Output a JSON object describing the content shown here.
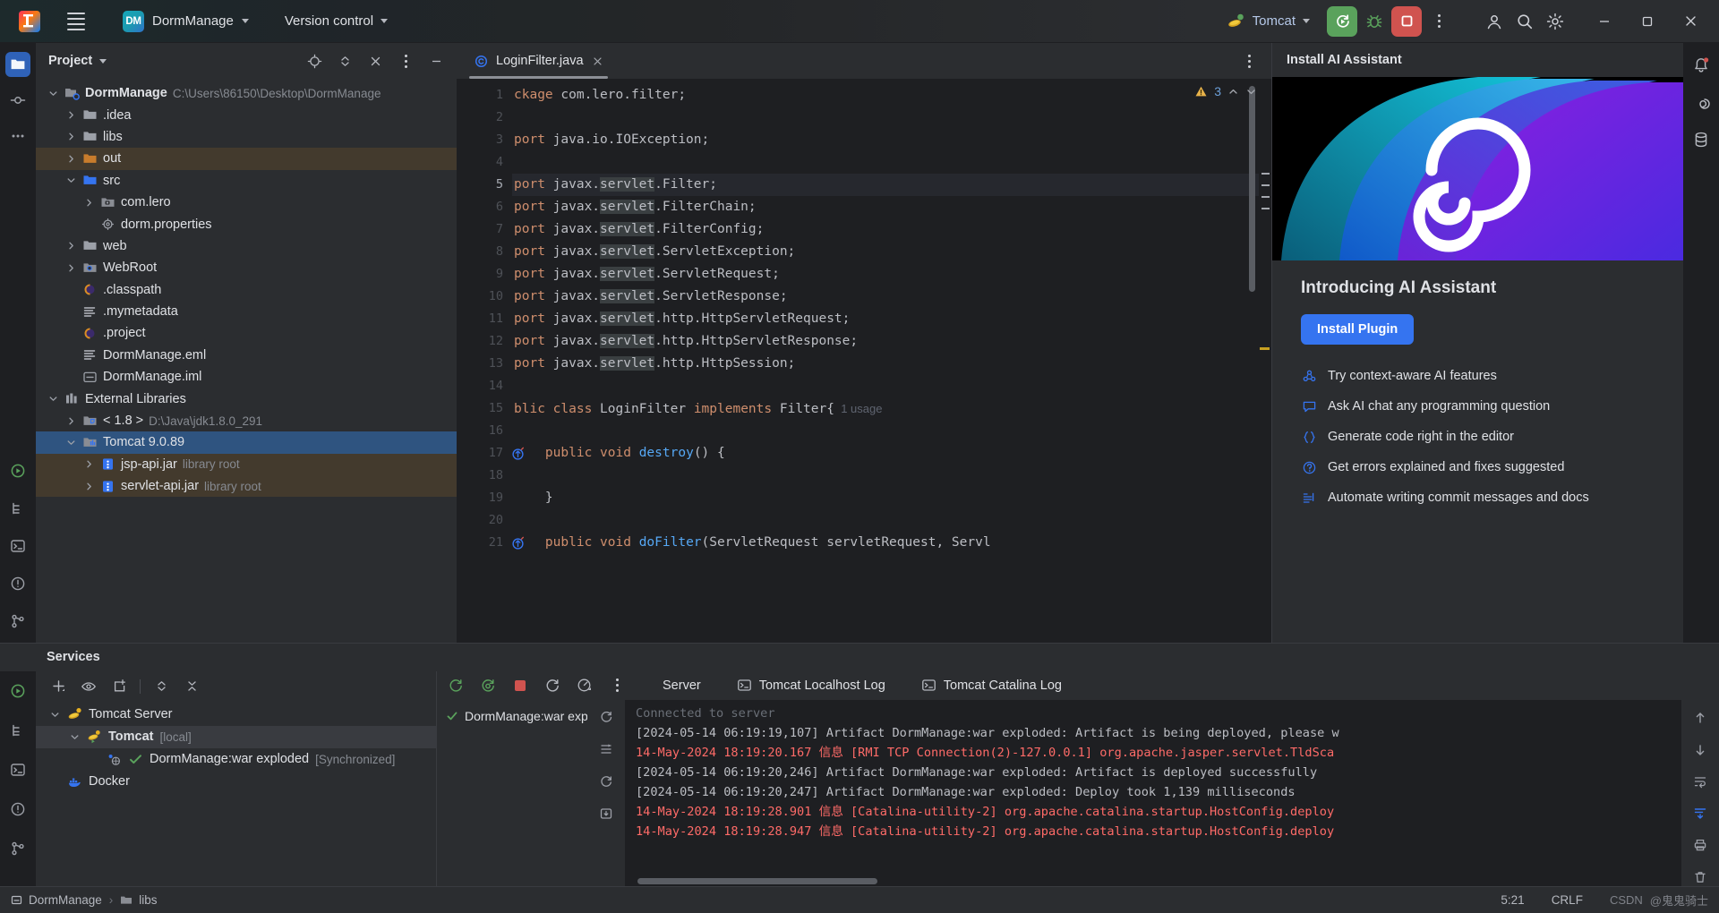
{
  "titlebar": {
    "menu_icon": "hamburger-icon",
    "project_badge": "DM",
    "project_name": "DormManage",
    "version_control": "Version control",
    "run_config": "Tomcat",
    "run_icon": "run-with-reload-icon",
    "debug_icon": "debug-icon",
    "stop_icon": "stop-icon",
    "more_icon": "kebab-icon",
    "account_icon": "account-icon",
    "search_icon": "search-icon",
    "settings_icon": "gear-icon",
    "minimize": "minimize-icon",
    "maximize": "maximize-icon",
    "close": "close-icon"
  },
  "left_rail": {
    "items": [
      {
        "name": "project-tool-window",
        "icon": "folder-icon",
        "active": true
      },
      {
        "name": "commit-tool-window",
        "icon": "commit-icon",
        "active": false
      },
      {
        "name": "more-tool-windows",
        "icon": "ellipsis-icon",
        "active": false
      }
    ],
    "bottom": [
      {
        "name": "run-tool-window",
        "icon": "run-icon"
      },
      {
        "name": "structure-tool-window",
        "icon": "structure-icon"
      },
      {
        "name": "terminal-tool-window",
        "icon": "terminal-icon"
      },
      {
        "name": "problems-tool-window",
        "icon": "problems-icon"
      },
      {
        "name": "version-control-tool-window",
        "icon": "branch-icon"
      }
    ]
  },
  "project_panel": {
    "title": "Project",
    "header_icons": [
      "locate-icon",
      "expand-collapse-icon",
      "close-icon",
      "kebab-icon",
      "minimize-icon"
    ],
    "tree": [
      {
        "depth": 0,
        "arrow": "down",
        "icon": "project-root-icon",
        "label": "DormManage",
        "bold": true,
        "sub": "C:\\Users\\86150\\Desktop\\DormManage",
        "state": "none"
      },
      {
        "depth": 1,
        "arrow": "right",
        "icon": "folder-icon",
        "label": ".idea",
        "bold": false,
        "sub": "",
        "state": "none"
      },
      {
        "depth": 1,
        "arrow": "right",
        "icon": "folder-icon",
        "label": "libs",
        "bold": false,
        "sub": "",
        "state": "none"
      },
      {
        "depth": 1,
        "arrow": "right",
        "icon": "folder-orange-icon",
        "label": "out",
        "bold": false,
        "sub": "",
        "state": "brown"
      },
      {
        "depth": 1,
        "arrow": "down",
        "icon": "folder-blue-icon",
        "label": "src",
        "bold": false,
        "sub": "",
        "state": "none"
      },
      {
        "depth": 2,
        "arrow": "right",
        "icon": "package-icon",
        "label": "com.lero",
        "bold": false,
        "sub": "",
        "state": "none"
      },
      {
        "depth": 2,
        "arrow": "none",
        "icon": "properties-icon",
        "label": "dorm.properties",
        "bold": false,
        "sub": "",
        "state": "none"
      },
      {
        "depth": 1,
        "arrow": "right",
        "icon": "folder-icon",
        "label": "web",
        "bold": false,
        "sub": "",
        "state": "none"
      },
      {
        "depth": 1,
        "arrow": "right",
        "icon": "webroot-icon",
        "label": "WebRoot",
        "bold": false,
        "sub": "",
        "state": "none"
      },
      {
        "depth": 1,
        "arrow": "none",
        "icon": "eclipse-file-icon",
        "label": ".classpath",
        "bold": false,
        "sub": "",
        "state": "none"
      },
      {
        "depth": 1,
        "arrow": "none",
        "icon": "text-file-icon",
        "label": ".mymetadata",
        "bold": false,
        "sub": "",
        "state": "none"
      },
      {
        "depth": 1,
        "arrow": "none",
        "icon": "eclipse-file-icon",
        "label": ".project",
        "bold": false,
        "sub": "",
        "state": "none"
      },
      {
        "depth": 1,
        "arrow": "none",
        "icon": "text-file-icon",
        "label": "DormManage.eml",
        "bold": false,
        "sub": "",
        "state": "none"
      },
      {
        "depth": 1,
        "arrow": "none",
        "icon": "module-icon",
        "label": "DormManage.iml",
        "bold": false,
        "sub": "",
        "state": "none"
      },
      {
        "depth": 0,
        "arrow": "down",
        "icon": "libraries-icon",
        "label": "External Libraries",
        "bold": false,
        "sub": "",
        "state": "none"
      },
      {
        "depth": 1,
        "arrow": "right",
        "icon": "jdk-icon",
        "label": "< 1.8 >",
        "bold": false,
        "sub": "D:\\Java\\jdk1.8.0_291",
        "state": "none"
      },
      {
        "depth": 1,
        "arrow": "down",
        "icon": "library-icon",
        "label": "Tomcat 9.0.89",
        "bold": false,
        "sub": "",
        "state": "blue"
      },
      {
        "depth": 2,
        "arrow": "right",
        "icon": "jar-icon",
        "label": "jsp-api.jar",
        "bold": false,
        "sub": "library root",
        "state": "brown"
      },
      {
        "depth": 2,
        "arrow": "right",
        "icon": "jar-icon",
        "label": "servlet-api.jar",
        "bold": false,
        "sub": "library root",
        "state": "brown"
      }
    ]
  },
  "editor": {
    "tab": {
      "label": "LoginFilter.java",
      "icon": "java-class-icon",
      "close": "close-icon"
    },
    "tab_more_icon": "kebab-icon",
    "warning_count": "3",
    "warning_icon": "warning-triangle-icon",
    "prev_icon": "chevron-up-icon",
    "next_icon": "chevron-down-icon",
    "lines": [
      {
        "no": "1",
        "current": false,
        "gutter_icon": "",
        "segments": [
          {
            "t": "ckage",
            "c": "kw"
          },
          {
            "t": " com.lero.filter;",
            "c": "pl"
          }
        ]
      },
      {
        "no": "2",
        "current": false,
        "gutter_icon": "",
        "segments": []
      },
      {
        "no": "3",
        "current": false,
        "gutter_icon": "",
        "segments": [
          {
            "t": "port",
            "c": "kw"
          },
          {
            "t": " java.io.IOException;",
            "c": "pl"
          }
        ]
      },
      {
        "no": "4",
        "current": false,
        "gutter_icon": "",
        "segments": []
      },
      {
        "no": "5",
        "current": true,
        "gutter_icon": "",
        "segments": [
          {
            "t": "port",
            "c": "kw"
          },
          {
            "t": " javax.",
            "c": "pl"
          },
          {
            "t": "servlet",
            "c": "hl"
          },
          {
            "t": ".Filter;",
            "c": "pl"
          }
        ]
      },
      {
        "no": "6",
        "current": false,
        "gutter_icon": "",
        "segments": [
          {
            "t": "port",
            "c": "kw"
          },
          {
            "t": " javax.",
            "c": "pl"
          },
          {
            "t": "servlet",
            "c": "hl"
          },
          {
            "t": ".FilterChain;",
            "c": "pl"
          }
        ]
      },
      {
        "no": "7",
        "current": false,
        "gutter_icon": "",
        "segments": [
          {
            "t": "port",
            "c": "kw"
          },
          {
            "t": " javax.",
            "c": "pl"
          },
          {
            "t": "servlet",
            "c": "hl"
          },
          {
            "t": ".FilterConfig;",
            "c": "pl"
          }
        ]
      },
      {
        "no": "8",
        "current": false,
        "gutter_icon": "",
        "segments": [
          {
            "t": "port",
            "c": "kw"
          },
          {
            "t": " javax.",
            "c": "pl"
          },
          {
            "t": "servlet",
            "c": "hl"
          },
          {
            "t": ".ServletException;",
            "c": "pl"
          }
        ]
      },
      {
        "no": "9",
        "current": false,
        "gutter_icon": "",
        "segments": [
          {
            "t": "port",
            "c": "kw"
          },
          {
            "t": " javax.",
            "c": "pl"
          },
          {
            "t": "servlet",
            "c": "hl"
          },
          {
            "t": ".ServletRequest;",
            "c": "pl"
          }
        ]
      },
      {
        "no": "10",
        "current": false,
        "gutter_icon": "",
        "segments": [
          {
            "t": "port",
            "c": "kw"
          },
          {
            "t": " javax.",
            "c": "pl"
          },
          {
            "t": "servlet",
            "c": "hl"
          },
          {
            "t": ".ServletResponse;",
            "c": "pl"
          }
        ]
      },
      {
        "no": "11",
        "current": false,
        "gutter_icon": "",
        "segments": [
          {
            "t": "port",
            "c": "kw"
          },
          {
            "t": " javax.",
            "c": "pl"
          },
          {
            "t": "servlet",
            "c": "hl"
          },
          {
            "t": ".http.HttpServletRequest;",
            "c": "pl"
          }
        ]
      },
      {
        "no": "12",
        "current": false,
        "gutter_icon": "",
        "segments": [
          {
            "t": "port",
            "c": "kw"
          },
          {
            "t": " javax.",
            "c": "pl"
          },
          {
            "t": "servlet",
            "c": "hl"
          },
          {
            "t": ".http.HttpServletResponse;",
            "c": "pl"
          }
        ]
      },
      {
        "no": "13",
        "current": false,
        "gutter_icon": "",
        "segments": [
          {
            "t": "port",
            "c": "kw"
          },
          {
            "t": " javax.",
            "c": "pl"
          },
          {
            "t": "servlet",
            "c": "hl"
          },
          {
            "t": ".http.HttpSession;",
            "c": "pl"
          }
        ]
      },
      {
        "no": "14",
        "current": false,
        "gutter_icon": "",
        "segments": []
      },
      {
        "no": "15",
        "current": false,
        "gutter_icon": "",
        "segments": [
          {
            "t": "blic",
            "c": "kw"
          },
          {
            "t": " ",
            "c": "pl"
          },
          {
            "t": "class",
            "c": "kw"
          },
          {
            "t": " LoginFilter ",
            "c": "pl"
          },
          {
            "t": "implements",
            "c": "kw"
          },
          {
            "t": " Filter{",
            "c": "pl"
          },
          {
            "t": "  1 usage",
            "c": "usage"
          }
        ]
      },
      {
        "no": "16",
        "current": false,
        "gutter_icon": "",
        "segments": []
      },
      {
        "no": "17",
        "current": false,
        "gutter_icon": "override-icon",
        "segments": [
          {
            "t": "    ",
            "c": "pl"
          },
          {
            "t": "public",
            "c": "kw"
          },
          {
            "t": " ",
            "c": "pl"
          },
          {
            "t": "void",
            "c": "kw"
          },
          {
            "t": " ",
            "c": "pl"
          },
          {
            "t": "destroy",
            "c": "fn"
          },
          {
            "t": "() {",
            "c": "pl"
          }
        ]
      },
      {
        "no": "18",
        "current": false,
        "gutter_icon": "",
        "segments": []
      },
      {
        "no": "19",
        "current": false,
        "gutter_icon": "",
        "segments": [
          {
            "t": "    }",
            "c": "pl"
          }
        ]
      },
      {
        "no": "20",
        "current": false,
        "gutter_icon": "",
        "segments": []
      },
      {
        "no": "21",
        "current": false,
        "gutter_icon": "override-icon",
        "segments": [
          {
            "t": "    ",
            "c": "pl"
          },
          {
            "t": "public",
            "c": "kw"
          },
          {
            "t": " ",
            "c": "pl"
          },
          {
            "t": "void",
            "c": "kw"
          },
          {
            "t": " ",
            "c": "pl"
          },
          {
            "t": "doFilter",
            "c": "fn"
          },
          {
            "t": "(ServletRequest servletRequest, Servl",
            "c": "pl"
          }
        ]
      }
    ]
  },
  "ai_panel": {
    "header": "Install AI Assistant",
    "title": "Introducing AI Assistant",
    "install_button": "Install Plugin",
    "features": [
      {
        "icon": "context-aware-icon",
        "label": "Try context-aware AI features"
      },
      {
        "icon": "chat-icon",
        "label": "Ask AI chat any programming question"
      },
      {
        "icon": "braces-icon",
        "label": "Generate code right in the editor"
      },
      {
        "icon": "question-icon",
        "label": "Get errors explained and fixes suggested"
      },
      {
        "icon": "commit-doc-icon",
        "label": "Automate writing commit messages and docs"
      }
    ]
  },
  "right_rail": {
    "items": [
      {
        "name": "notifications",
        "icon": "bell-icon"
      },
      {
        "name": "ai-assistant",
        "icon": "ai-icon"
      },
      {
        "name": "database",
        "icon": "database-icon"
      }
    ]
  },
  "services": {
    "title": "Services",
    "toolbar": [
      {
        "name": "add",
        "icon": "plus-icon"
      },
      {
        "name": "show",
        "icon": "eye-icon"
      },
      {
        "name": "new-tab",
        "icon": "new-tab-icon"
      },
      {
        "name": "expand-collapse",
        "icon": "expand-collapse-icon"
      },
      {
        "name": "collapse-all",
        "icon": "collapse-all-icon"
      }
    ],
    "tree": [
      {
        "depth": 0,
        "arrow": "down",
        "icon": "tomcat-icon",
        "label": "Tomcat Server",
        "bold": false,
        "sub": "",
        "sel": false,
        "check": false
      },
      {
        "depth": 1,
        "arrow": "down",
        "icon": "tomcat-run-icon",
        "label": "Tomcat",
        "bold": true,
        "sub": "[local]",
        "sel": true,
        "check": false
      },
      {
        "depth": 2,
        "arrow": "none",
        "icon": "artifact-icon",
        "label": "DormManage:war exploded",
        "bold": false,
        "sub": "[Synchronized]",
        "sel": false,
        "check": true
      },
      {
        "depth": 0,
        "arrow": "none",
        "icon": "docker-icon",
        "label": "Docker",
        "bold": false,
        "sub": "",
        "sel": false,
        "check": false
      }
    ],
    "right_toolbar": [
      {
        "name": "rerun",
        "icon": "rerun-icon"
      },
      {
        "name": "rerun-debug",
        "icon": "rerun-debug-icon"
      },
      {
        "name": "stop",
        "icon": "stop-icon"
      },
      {
        "name": "restart",
        "icon": "restart-icon"
      },
      {
        "name": "profiler",
        "icon": "profiler-icon"
      },
      {
        "name": "more",
        "icon": "kebab-icon"
      }
    ],
    "console_tabs": [
      {
        "label": "Server",
        "icon": "",
        "active": true
      },
      {
        "label": "Tomcat Localhost Log",
        "icon": "console-icon",
        "active": false
      },
      {
        "label": "Tomcat Catalina Log",
        "icon": "console-icon",
        "active": false
      }
    ],
    "deployment": {
      "label": "DormManage:war explod",
      "icon": "check-icon"
    },
    "console_rail": [
      {
        "name": "rerun-app",
        "icon": "rerun-small-icon"
      },
      {
        "name": "scroll-to-stack",
        "icon": "stack-icon"
      },
      {
        "name": "update-app",
        "icon": "update-icon"
      },
      {
        "name": "redeploy",
        "icon": "redeploy-icon"
      }
    ],
    "console_side": [
      {
        "name": "scroll-up",
        "icon": "arrow-up-icon"
      },
      {
        "name": "scroll-down",
        "icon": "arrow-down-icon"
      },
      {
        "name": "soft-wrap",
        "icon": "wrap-icon"
      },
      {
        "name": "scroll-to-end",
        "icon": "scroll-end-icon"
      },
      {
        "name": "print",
        "icon": "print-icon"
      },
      {
        "name": "clear-all",
        "icon": "trash-icon"
      }
    ],
    "log_lines": [
      {
        "text": "Connected to server",
        "color": "g"
      },
      {
        "text": "[2024-05-14 06:19:19,107] Artifact DormManage:war exploded: Artifact is being deployed, please w",
        "color": "w"
      },
      {
        "text": "14-May-2024 18:19:20.167 信息 [RMI TCP Connection(2)-127.0.0.1] org.apache.jasper.servlet.TldSca",
        "color": "r"
      },
      {
        "text": "[2024-05-14 06:19:20,246] Artifact DormManage:war exploded: Artifact is deployed successfully",
        "color": "w"
      },
      {
        "text": "[2024-05-14 06:19:20,247] Artifact DormManage:war exploded: Deploy took 1,139 milliseconds",
        "color": "w"
      },
      {
        "text": "14-May-2024 18:19:28.901 信息 [Catalina-utility-2] org.apache.catalina.startup.HostConfig.deploy",
        "color": "r"
      },
      {
        "text": "14-May-2024 18:19:28.947 信息 [Catalina-utility-2] org.apache.catalina.startup.HostConfig.deploy",
        "color": "r"
      }
    ]
  },
  "statusbar": {
    "crumb_project": "DormManage",
    "crumb_folder": "libs",
    "caret": "5:21",
    "line_sep": "CRLF",
    "watermark_prefix": "CSDN",
    "watermark_author": "@鬼鬼骑士"
  }
}
